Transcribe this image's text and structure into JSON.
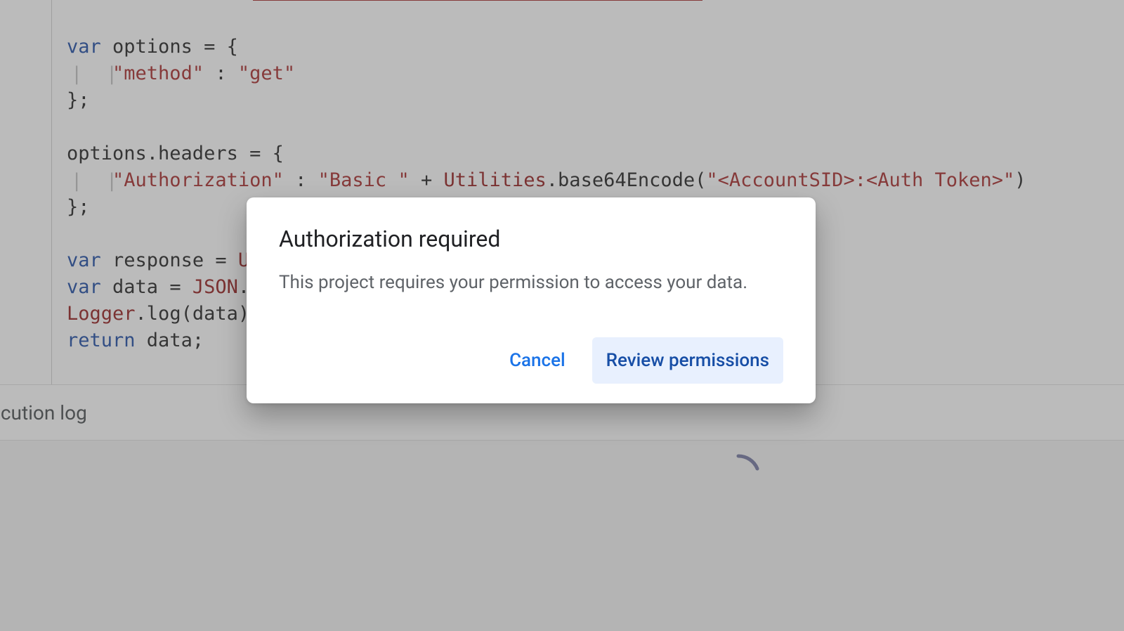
{
  "code": {
    "line1": {
      "kw": "var",
      "name": " options ",
      "rest": "= {"
    },
    "line2": {
      "strKey": "\"method\"",
      "colon": " : ",
      "strVal": "\"get\""
    },
    "line3": {
      "text": "};"
    },
    "line5": {
      "prefix": "options.headers = {"
    },
    "line6": {
      "strKey": "\"Authorization\"",
      "colon": " : ",
      "strBasic": "\"Basic \"",
      "plus": " + ",
      "util": "Utilities",
      "method": ".base64Encode(",
      "strArg": "\"<AccountSID>:<Auth Token>\"",
      "close": ")"
    },
    "line7": {
      "text": "};"
    },
    "line9": {
      "kw": "var",
      "name": " response ",
      "rest": "= ",
      "trailing": "U"
    },
    "line10": {
      "kw": "var",
      "name": " data ",
      "rest": "= ",
      "json": "JSON",
      "method": ".p"
    },
    "line11": {
      "logger": "Logger",
      "method": ".log(data);"
    },
    "line12": {
      "kw": "return",
      "rest": " data;"
    }
  },
  "panel": {
    "executionLabel": "ecution log"
  },
  "spinner": {
    "glyph": ")"
  },
  "dialog": {
    "title": "Authorization required",
    "body": "This project requires your permission to access your data.",
    "cancel": "Cancel",
    "review": "Review permissions"
  }
}
